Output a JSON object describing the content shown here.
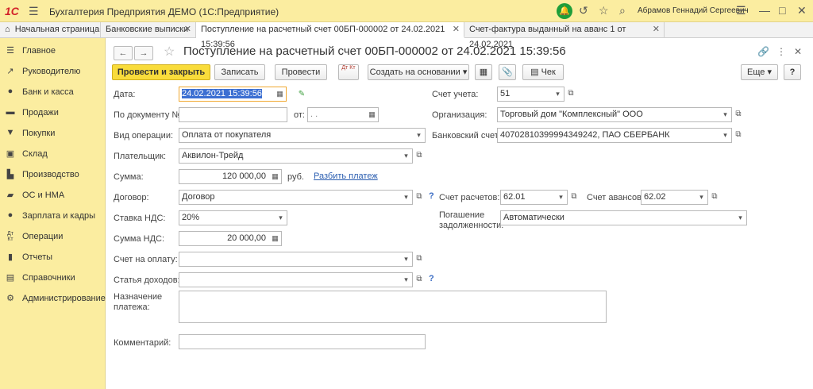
{
  "app": {
    "logo": "1С",
    "title": "Бухгалтерия Предприятия ДЕМО  (1С:Предприятие)",
    "user": "Абрамов Геннадий Сергеевич"
  },
  "tabs": [
    {
      "label": "Начальная страница"
    },
    {
      "label": "Банковские выписки"
    },
    {
      "label": "Поступление на расчетный счет 00БП-000002 от 24.02.2021 15:39:56"
    },
    {
      "label": "Счет-фактура выданный на аванс 1 от 24.02.2021"
    }
  ],
  "sidebar": {
    "items": [
      {
        "label": "Главное",
        "icon": "menu-icon"
      },
      {
        "label": "Руководителю",
        "icon": "chart-icon"
      },
      {
        "label": "Банк и касса",
        "icon": "coin-icon"
      },
      {
        "label": "Продажи",
        "icon": "cart-icon"
      },
      {
        "label": "Покупки",
        "icon": "basket-icon"
      },
      {
        "label": "Склад",
        "icon": "warehouse-icon"
      },
      {
        "label": "Производство",
        "icon": "factory-icon"
      },
      {
        "label": "ОС и НМА",
        "icon": "truck-icon"
      },
      {
        "label": "Зарплата и кадры",
        "icon": "people-icon"
      },
      {
        "label": "Операции",
        "icon": "dt-kt-icon"
      },
      {
        "label": "Отчеты",
        "icon": "bar-chart-icon"
      },
      {
        "label": "Справочники",
        "icon": "book-icon"
      },
      {
        "label": "Администрирование",
        "icon": "gear-icon"
      }
    ]
  },
  "doc": {
    "title": "Поступление на расчетный счет 00БП-000002 от 24.02.2021 15:39:56"
  },
  "toolbar": {
    "post_close": "Провести и закрыть",
    "save": "Записать",
    "post": "Провести",
    "dtkt": "Дт Кт",
    "create_basis": "Создать на основании",
    "check": "Чек",
    "more": "Еще",
    "help": "?"
  },
  "form": {
    "date_label": "Дата:",
    "date_value": "24.02.2021 15:39:56",
    "doc_no_label": "По документу №:",
    "doc_no_value": "",
    "from_label": "от:",
    "from_value": " .  .",
    "op_label": "Вид операции:",
    "op_value": "Оплата от покупателя",
    "payer_label": "Плательщик:",
    "payer_value": "Аквилон-Трейд",
    "sum_label": "Сумма:",
    "sum_value": "120 000,00",
    "currency": "руб.",
    "split_link": "Разбить платеж",
    "contract_label": "Договор:",
    "contract_value": "Договор",
    "vat_rate_label": "Ставка НДС:",
    "vat_rate_value": "20%",
    "vat_sum_label": "Сумма НДС:",
    "vat_sum_value": "20 000,00",
    "invoice_label": "Счет на оплату:",
    "invoice_value": "",
    "income_label": "Статья доходов:",
    "income_value": "",
    "purpose_label": "Назначение платежа:",
    "purpose_value": "",
    "comment_label": "Комментарий:",
    "comment_value": "",
    "account_label": "Счет учета:",
    "account_value": "51",
    "org_label": "Организация:",
    "org_value": "Торговый дом \"Комплексный\" ООО",
    "bank_label": "Банковский счет:",
    "bank_value": "40702810399994349242, ПАО СБЕРБАНК",
    "settle_label": "Счет расчетов:",
    "settle_value": "62.01",
    "advance_label": "Счет авансов:",
    "advance_value": "62.02",
    "repay_label": "Погашение задолженности:",
    "repay_value": "Автоматически"
  }
}
